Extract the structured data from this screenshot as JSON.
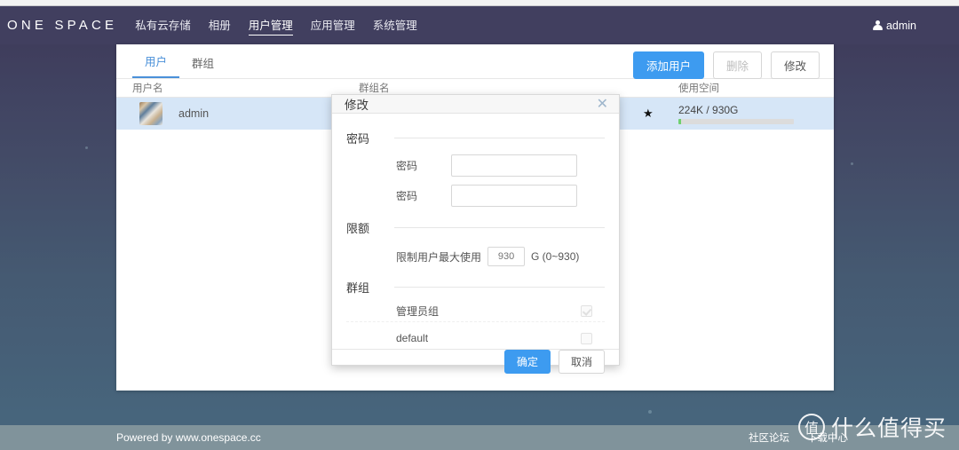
{
  "navbar": {
    "brand": "ONE SPACE",
    "links": [
      {
        "label": "私有云存储",
        "active": false
      },
      {
        "label": "相册",
        "active": false
      },
      {
        "label": "用户管理",
        "active": true
      },
      {
        "label": "应用管理",
        "active": false
      },
      {
        "label": "系统管理",
        "active": false
      }
    ],
    "user": "admin",
    "user_icon": "user-icon"
  },
  "card": {
    "tabs": [
      {
        "label": "用户",
        "active": true
      },
      {
        "label": "群组",
        "active": false
      }
    ],
    "actions": {
      "add": "添加用户",
      "delete": "删除",
      "modify": "修改"
    },
    "table": {
      "headers": {
        "username": "用户名",
        "groupname": "群组名",
        "space": "使用空间"
      },
      "rows": [
        {
          "avatar": "user-avatar",
          "username": "admin",
          "groupname": "",
          "star": "★",
          "space_text": "224K / 930G",
          "space_percent": 2
        }
      ]
    }
  },
  "modal": {
    "title": "修改",
    "close_icon": "close-icon",
    "sections": {
      "password": "密码",
      "quota": "限额",
      "groups": "群组"
    },
    "password_fields": [
      {
        "label": "密码",
        "value": "",
        "placeholder": ""
      },
      {
        "label": "密码",
        "value": "",
        "placeholder": ""
      }
    ],
    "quota": {
      "label": "限制用户最大使用",
      "value": "",
      "placeholder": "930",
      "unit": "G (0~930)"
    },
    "groups": [
      {
        "name": "管理员组",
        "checked": true,
        "disabled": true
      },
      {
        "name": "default",
        "checked": false,
        "disabled": false
      }
    ],
    "buttons": {
      "confirm": "确定",
      "cancel": "取消"
    }
  },
  "footer": {
    "powered_by": "Powered by www.onespace.cc",
    "links": [
      {
        "label": "社区论坛"
      },
      {
        "label": "下载中心"
      }
    ]
  },
  "watermark": {
    "badge": "值",
    "text": "什么值得买"
  },
  "colors": {
    "accent": "#3d9bf0",
    "nav_bg": "#413f5f",
    "row_selected": "#d6e6f7",
    "footer_bg": "#80939b",
    "progress_fill": "#6fd06f"
  }
}
